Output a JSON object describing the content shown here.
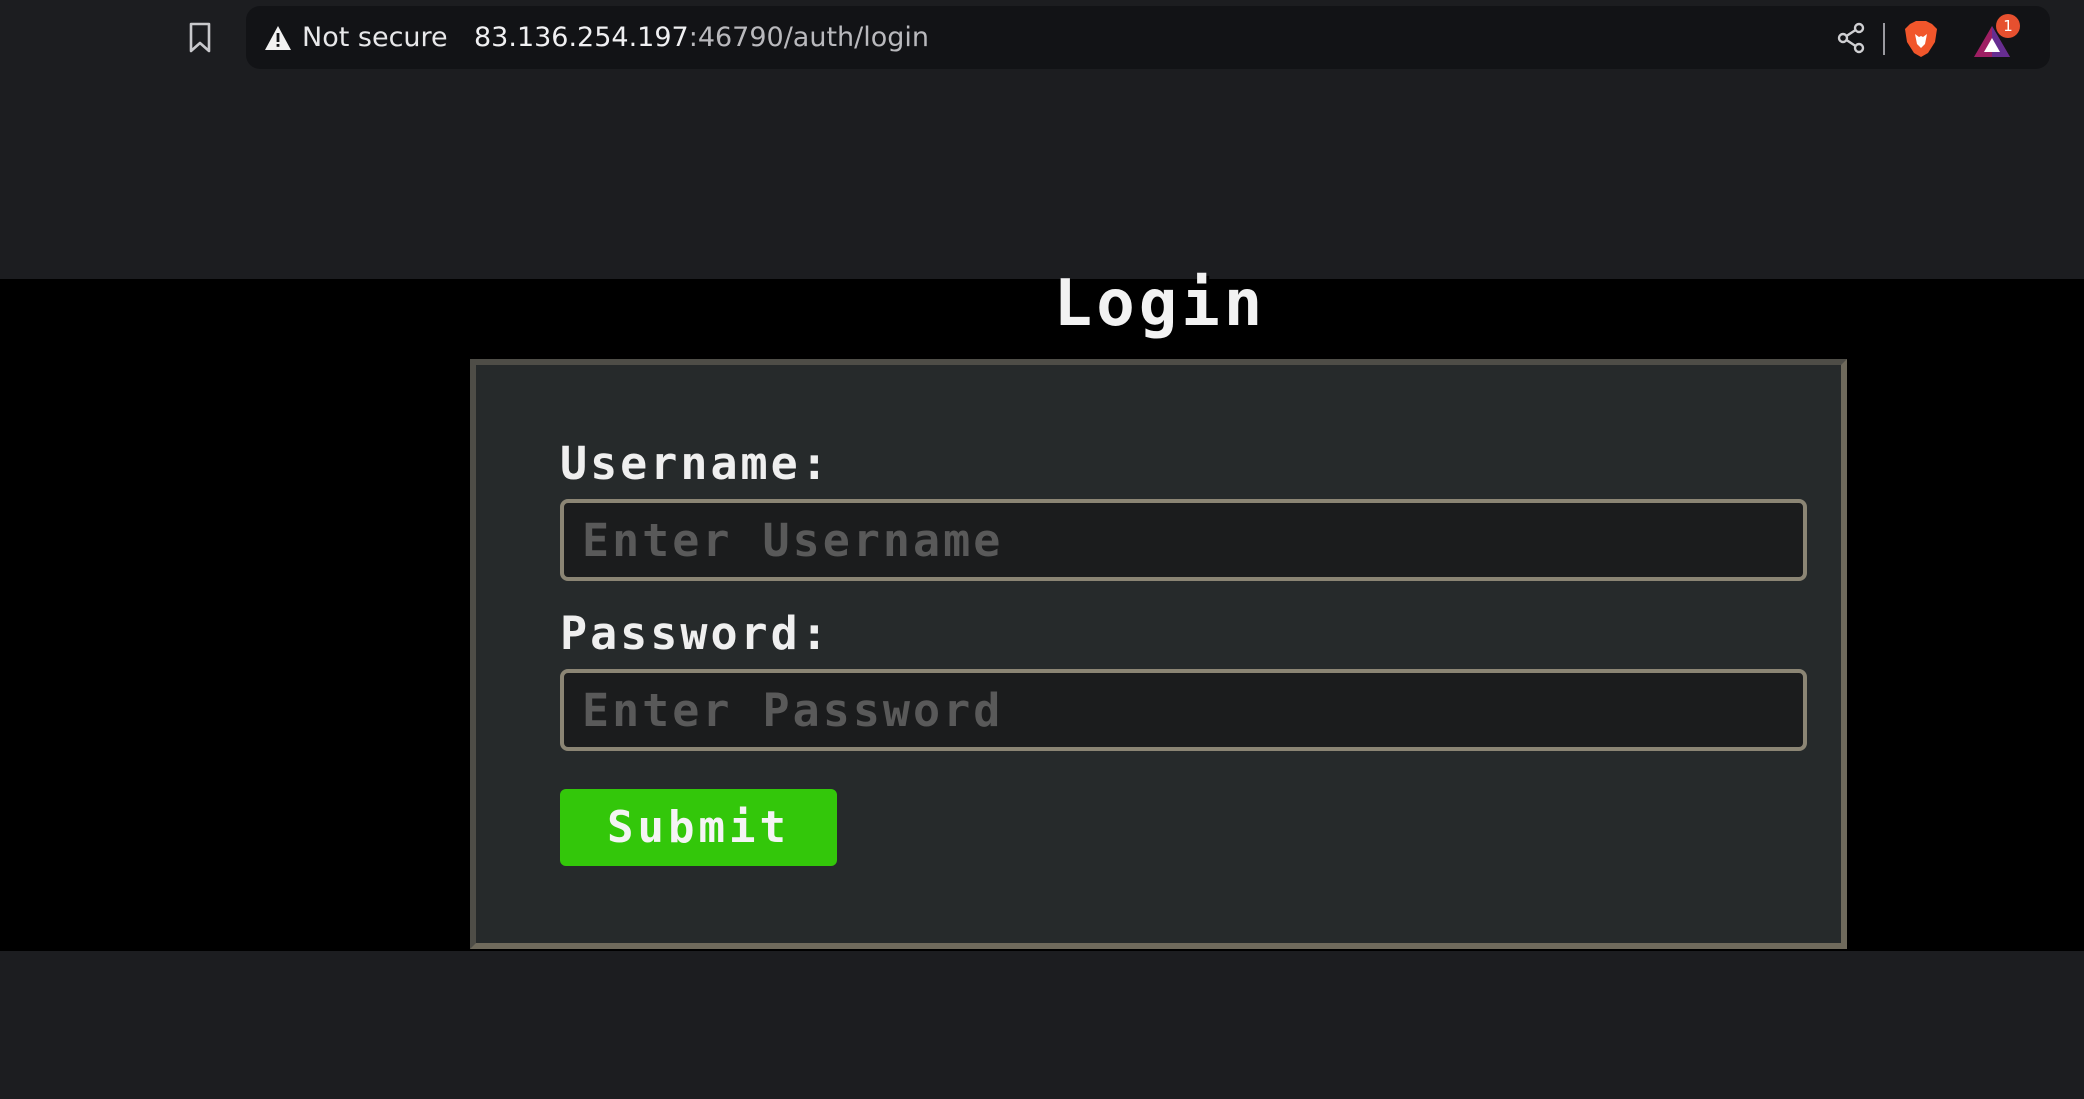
{
  "browser": {
    "security_label": "Not secure",
    "url_host": "83.136.254.197",
    "url_rest": ":46790/auth/login",
    "notification_count": "1",
    "icons": [
      "bookmark-icon",
      "warning-icon",
      "share-icon",
      "brave-lion-icon",
      "brave-rewards-icon"
    ]
  },
  "page": {
    "title": "Login",
    "username_label": "Username:",
    "username_placeholder": "Enter Username",
    "password_label": "Password:",
    "password_placeholder": "Enter Password",
    "submit_label": "Submit"
  },
  "colors": {
    "background": "#000000",
    "card": "#262a2b",
    "card_border": "#6f6a5c",
    "submit": "#33c70a"
  }
}
